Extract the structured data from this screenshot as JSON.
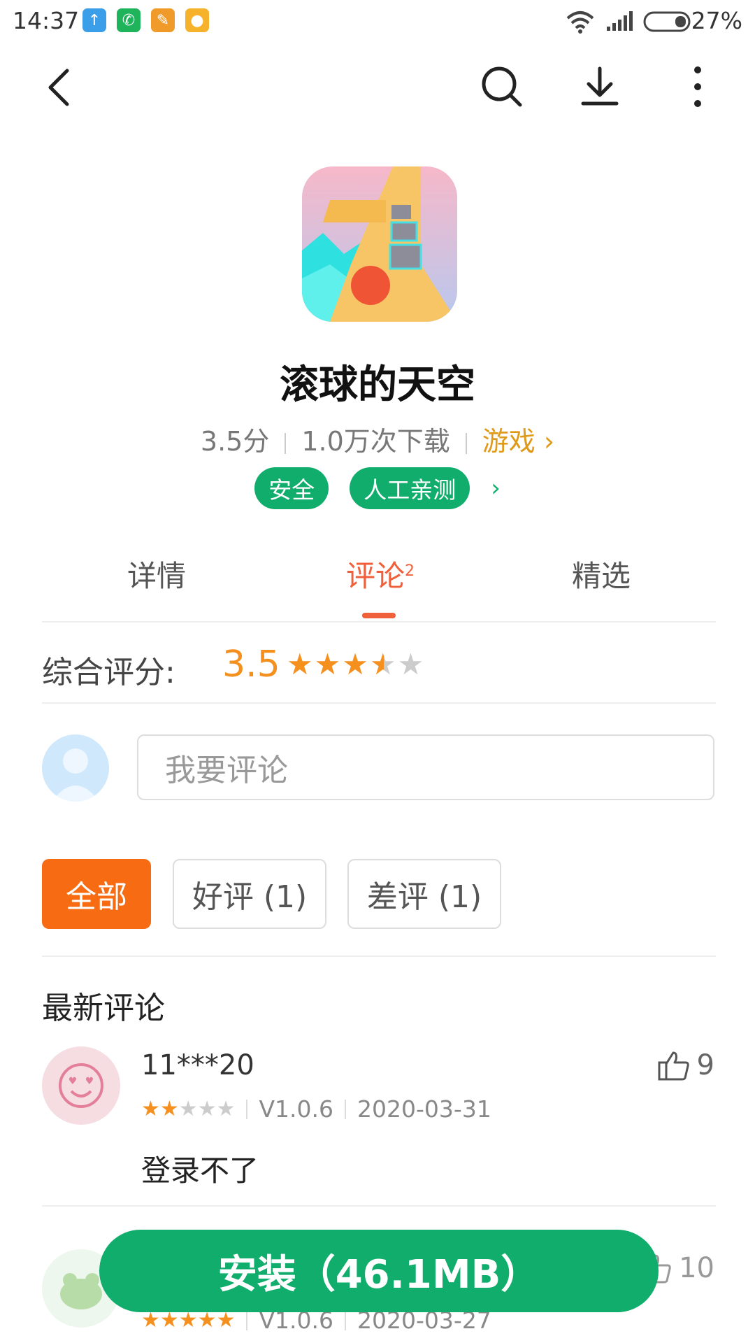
{
  "status_bar": {
    "time": "14:37",
    "battery": "27%"
  },
  "app": {
    "name": "滚球的天空",
    "rating": "3.5分",
    "downloads": "1.0万次下载",
    "category": "游戏",
    "badges": [
      "安全",
      "人工亲测"
    ]
  },
  "tabs": [
    {
      "label": "详情"
    },
    {
      "label": "评论",
      "count": "2"
    },
    {
      "label": "精选"
    }
  ],
  "overall": {
    "label": "综合评分:",
    "value": "3.5",
    "stars": 3.5
  },
  "comment_input": {
    "placeholder": "我要评论"
  },
  "filters": [
    "全部",
    "好评 (1)",
    "差评 (1)"
  ],
  "section_title": "最新评论",
  "reviews": [
    {
      "user": "11***20",
      "stars": 2,
      "version": "V1.0.6",
      "date": "2020-03-31",
      "text": "登录不了",
      "likes": "9"
    },
    {
      "user": "",
      "stars": 5,
      "version": "V1.0.6",
      "date": "2020-03-27",
      "text": "",
      "likes": "10"
    }
  ],
  "install_button": "安装（46.1MB）",
  "colors": {
    "accent_orange": "#f76b12",
    "tab_active": "#f0603a",
    "green": "#10ad6c",
    "star": "#f5901e"
  }
}
